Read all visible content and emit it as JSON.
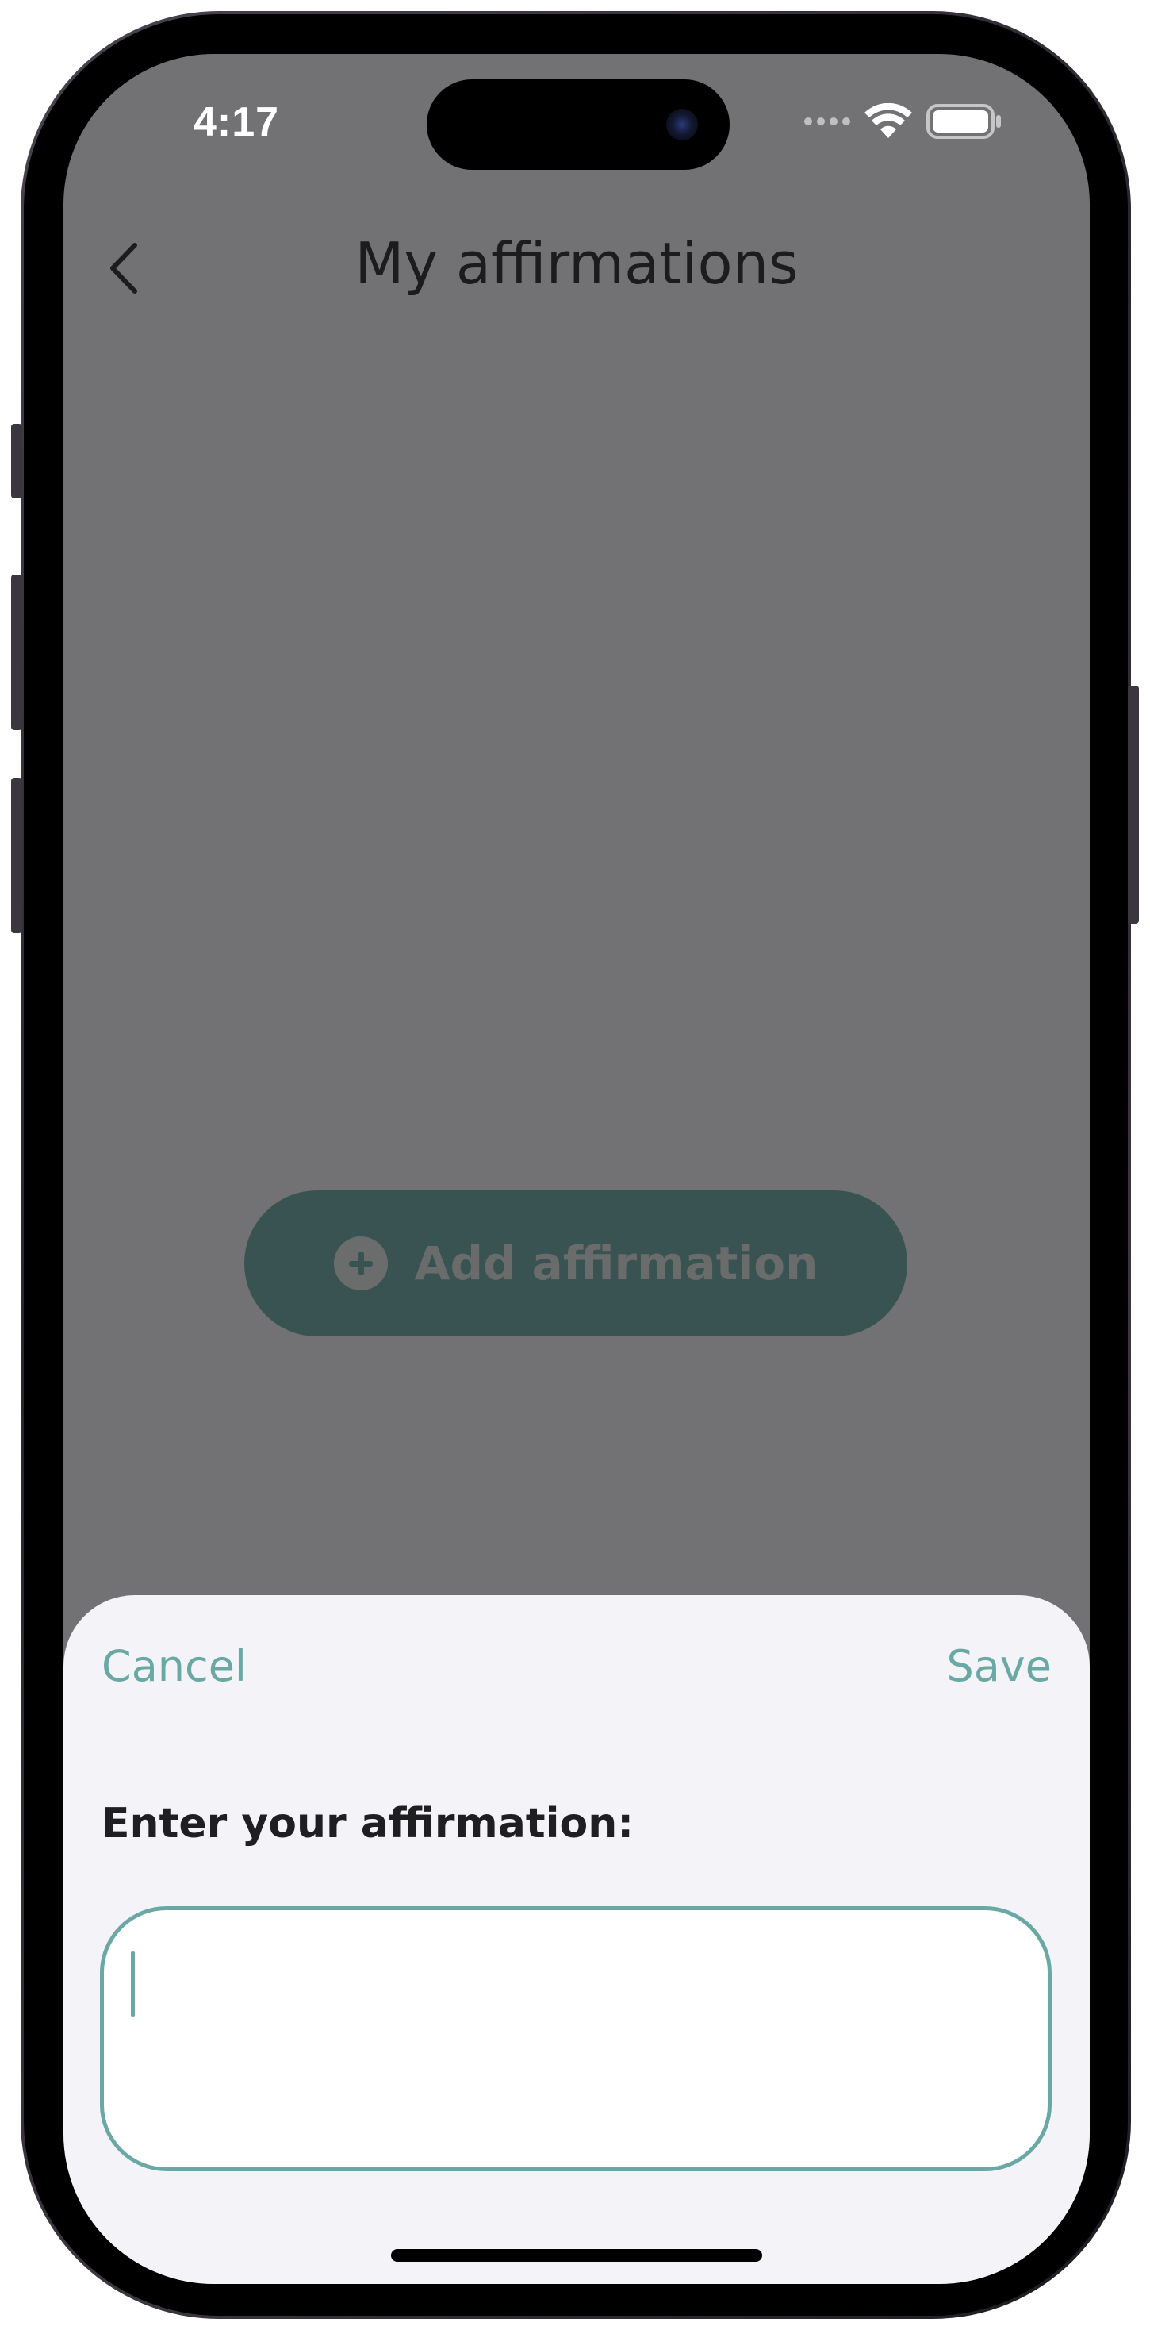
{
  "status_bar": {
    "time": "4:17",
    "icons": [
      "cellular-dots-icon",
      "wifi-icon",
      "battery-icon"
    ]
  },
  "nav": {
    "back_icon": "chevron-left-icon",
    "title": "My affirmations"
  },
  "main": {
    "add_button_label": "Add affirmation",
    "add_button_icon": "plus-circle-icon"
  },
  "sheet": {
    "cancel_label": "Cancel",
    "save_label": "Save",
    "prompt_label": "Enter your affirmation:",
    "input_value": ""
  },
  "colors": {
    "accent": "#6aa8a5",
    "overlay": "#727173",
    "button_dimmed": "#385351",
    "sheet_background": "#f4f4f8"
  }
}
